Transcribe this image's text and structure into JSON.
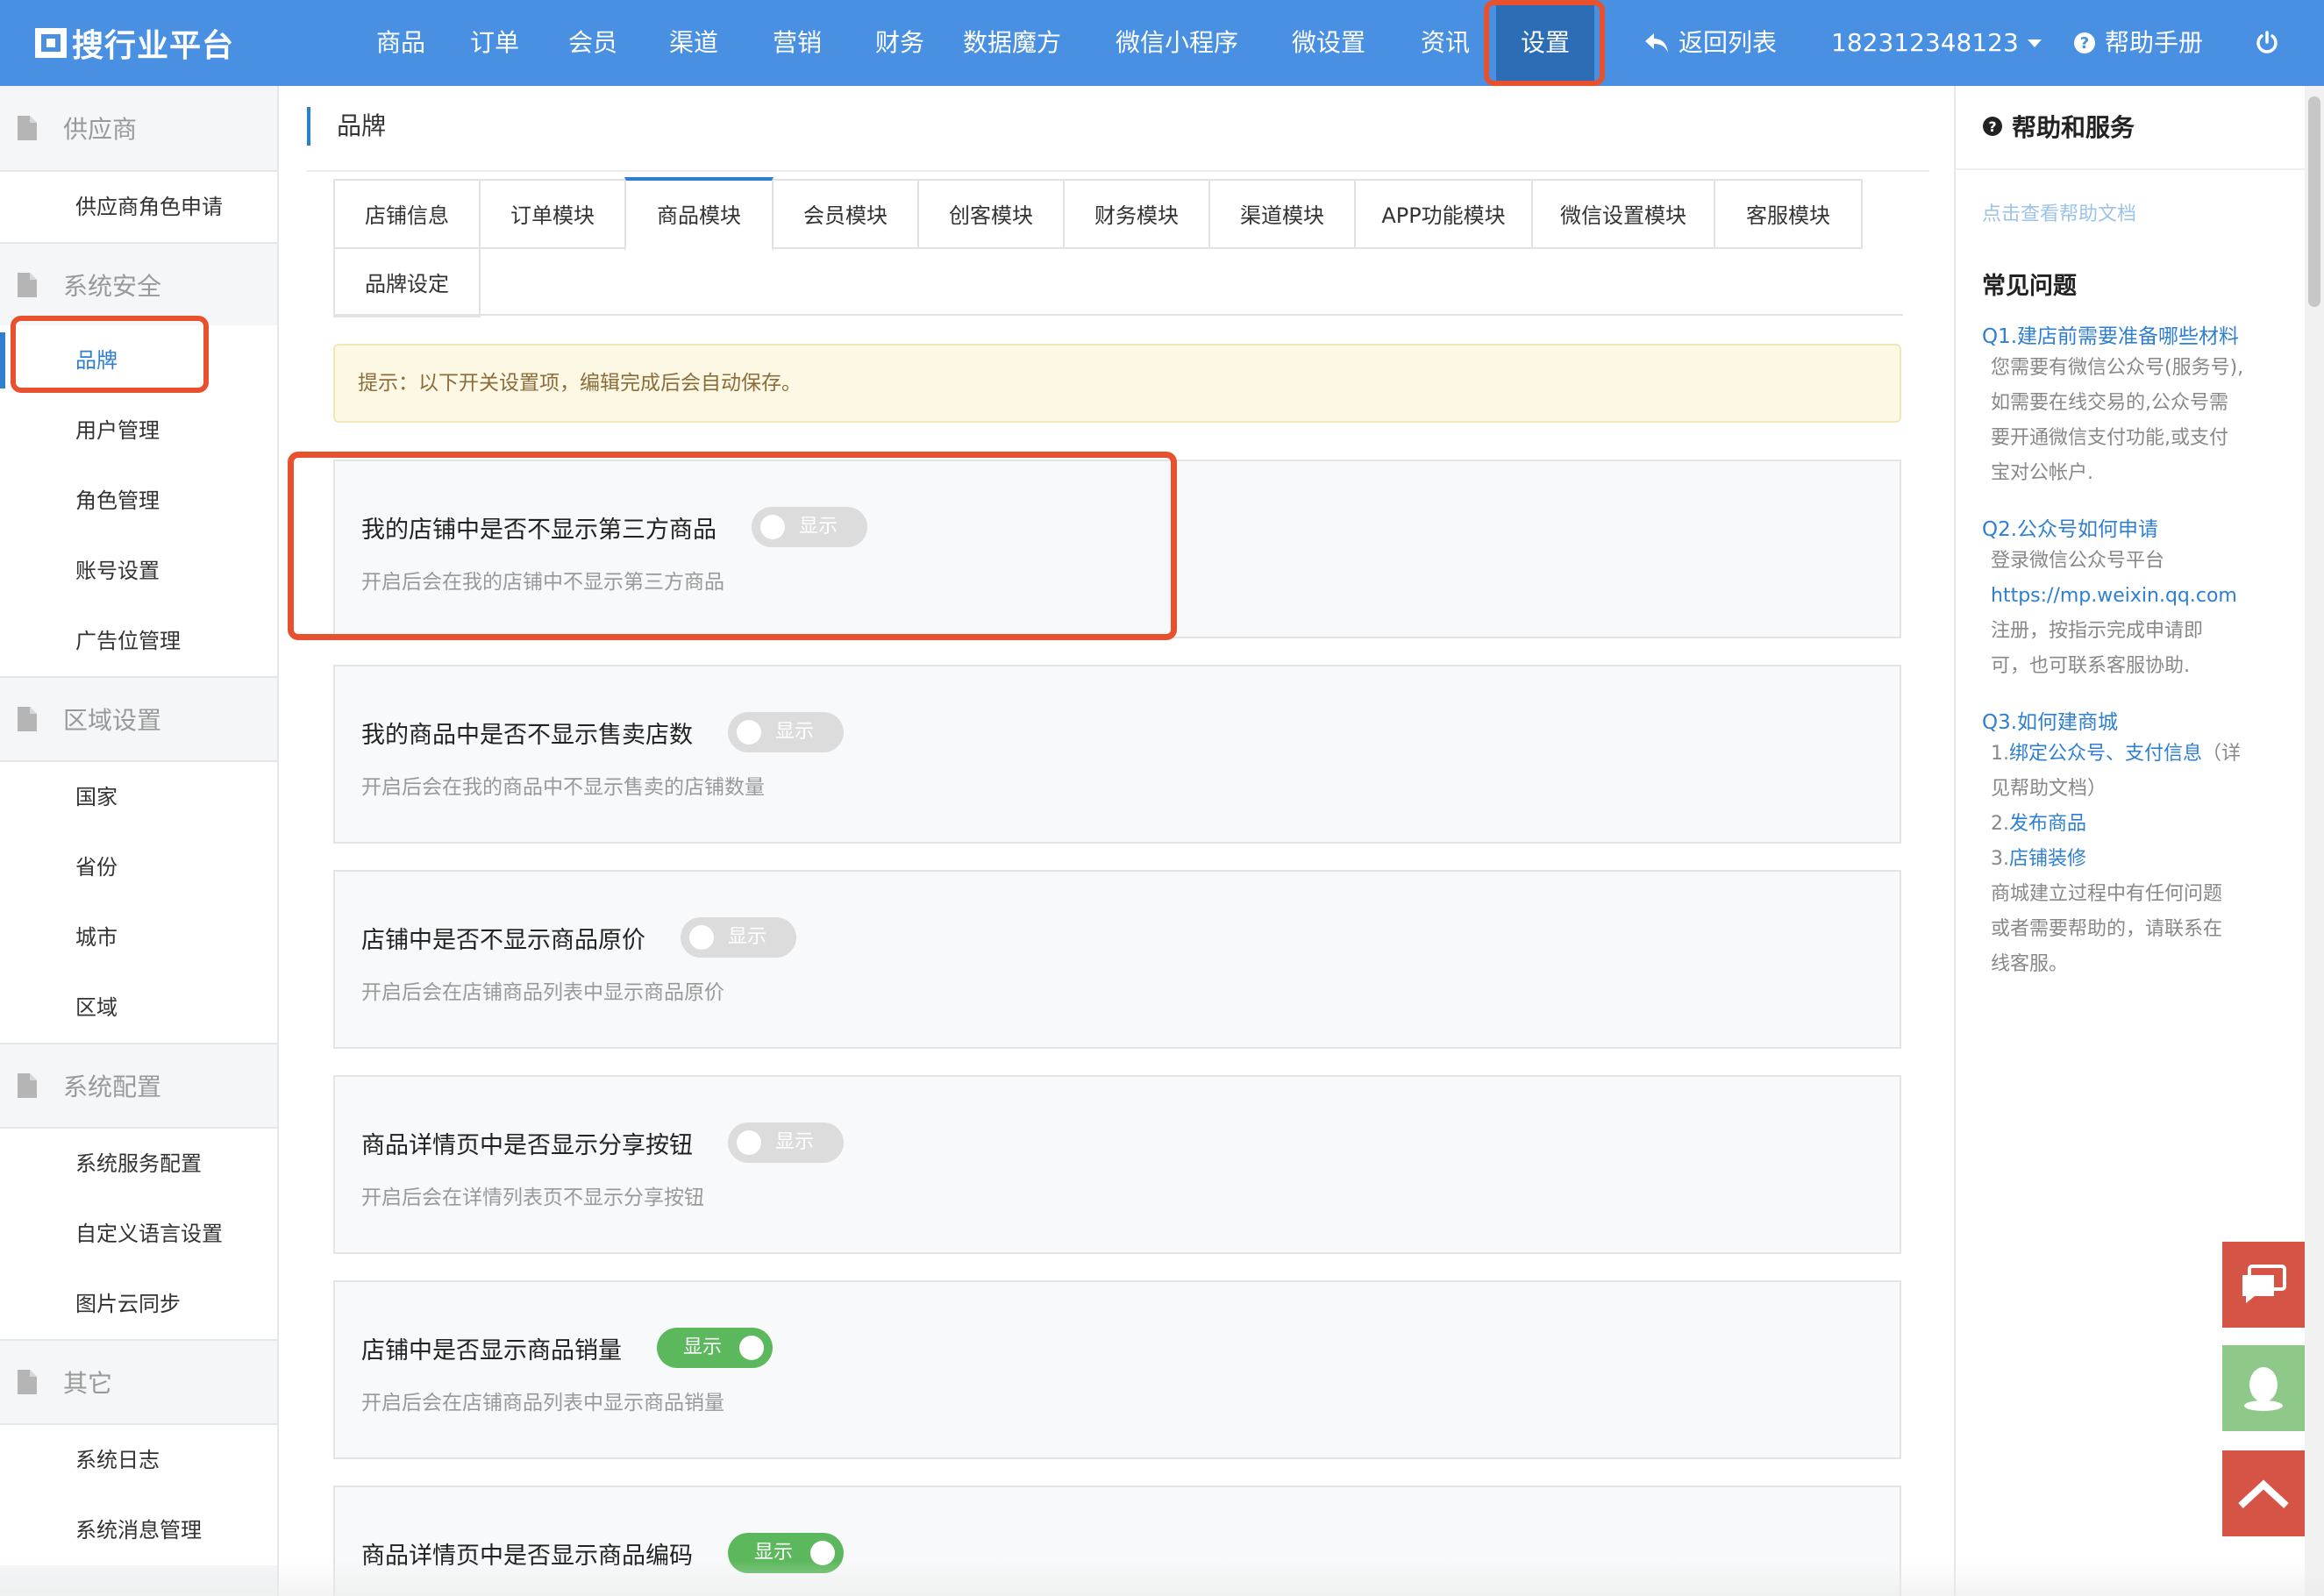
{
  "app": {
    "logo_text": "搜行业平台"
  },
  "topnav": {
    "items": [
      "商品",
      "订单",
      "会员",
      "渠道",
      "营销",
      "财务",
      "数据魔方",
      "微信小程序",
      "微设置",
      "资讯",
      "设置"
    ],
    "active": "设置",
    "back_label": "返回列表",
    "account": "182312348123",
    "help_label": "帮助手册"
  },
  "sidebar": {
    "sections": [
      {
        "title": "供应商",
        "items": [
          "供应商角色申请"
        ]
      },
      {
        "title": "系统安全",
        "items": [
          "品牌",
          "用户管理",
          "角色管理",
          "账号设置",
          "广告位管理"
        ]
      },
      {
        "title": "区域设置",
        "items": [
          "国家",
          "省份",
          "城市",
          "区域"
        ]
      },
      {
        "title": "系统配置",
        "items": [
          "系统服务配置",
          "自定义语言设置",
          "图片云同步"
        ]
      },
      {
        "title": "其它",
        "items": [
          "系统日志",
          "系统消息管理"
        ]
      }
    ],
    "active_item": "品牌"
  },
  "main": {
    "page_title": "品牌",
    "tabs": [
      "店铺信息",
      "订单模块",
      "商品模块",
      "会员模块",
      "创客模块",
      "财务模块",
      "渠道模块",
      "APP功能模块",
      "微信设置模块",
      "客服模块",
      "品牌设定"
    ],
    "active_tab": "商品模块",
    "tip": "提示：以下开关设置项，编辑完成后会自动保存。",
    "settings": [
      {
        "title": "我的店铺中是否不显示第三方商品",
        "desc": "开启后会在我的店铺中不显示第三方商品",
        "toggle_label": "显示",
        "on": false
      },
      {
        "title": "我的商品中是否不显示售卖店数",
        "desc": "开启后会在我的商品中不显示售卖的店铺数量",
        "toggle_label": "显示",
        "on": false
      },
      {
        "title": "店铺中是否不显示商品原价",
        "desc": "开启后会在店铺商品列表中显示商品原价",
        "toggle_label": "显示",
        "on": false
      },
      {
        "title": "商品详情页中是否显示分享按钮",
        "desc": "开启后会在详情列表页不显示分享按钮",
        "toggle_label": "显示",
        "on": false
      },
      {
        "title": "店铺中是否显示商品销量",
        "desc": "开启后会在店铺商品列表中显示商品销量",
        "toggle_label": "显示",
        "on": true
      },
      {
        "title": "商品详情页中是否显示商品编码",
        "desc": "",
        "toggle_label": "显示",
        "on": true
      }
    ]
  },
  "help": {
    "title": "帮助和服务",
    "doc_link": "点击查看帮助文档",
    "faq_heading": "常见问题",
    "q1": "Q1.建店前需要准备哪些材料",
    "a1": [
      "您需要有微信公众号(服务号),",
      "如需要在线交易的,公众号需",
      "要开通微信支付功能,或支付",
      "宝对公帐户."
    ],
    "q2": "Q2.公众号如何申请",
    "a2": [
      "登录微信公众号平台",
      "https://mp.weixin.qq.com",
      "注册，按指示完成申请即",
      "可，也可联系客服协助."
    ],
    "q3": "Q3.如何建商城",
    "a3_1a": "1.",
    "a3_1b": "绑定公众号、支付信息",
    "a3_1c": "（详",
    "a3_1d": "见帮助文档）",
    "a3_2a": "2.",
    "a3_2b": "发布商品",
    "a3_3a": "3.",
    "a3_3b": "店铺装修",
    "a3_rest": [
      "商城建立过程中有任何问题",
      "或者需要帮助的，请联系在",
      "线客服。"
    ]
  },
  "colors": {
    "nav_bg": "#4a90e2",
    "nav_active": "#2c6db5",
    "accent": "#2f7fd1",
    "highlight": "#e8512d",
    "toggle_on": "#5cb85c",
    "toggle_off": "#dcdcdc"
  }
}
